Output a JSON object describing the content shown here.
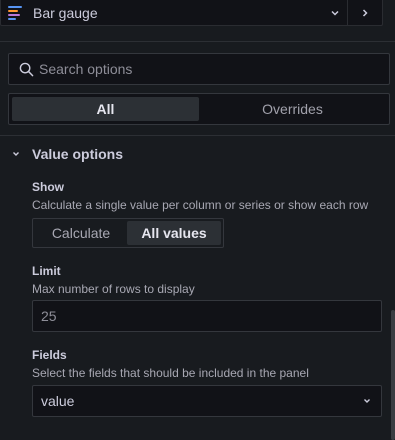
{
  "visualization": {
    "name": "Bar gauge",
    "icon": "bar-gauge-icon",
    "icon_colors": [
      "#5794f2",
      "#ff9830",
      "#b877d9"
    ]
  },
  "search": {
    "placeholder": "Search options",
    "value": ""
  },
  "tabs": [
    {
      "label": "All",
      "active": true
    },
    {
      "label": "Overrides",
      "active": false
    }
  ],
  "section": {
    "title": "Value options",
    "expanded": true
  },
  "show": {
    "label": "Show",
    "description": "Calculate a single value per column or series or show each row",
    "options": [
      {
        "label": "Calculate",
        "active": false
      },
      {
        "label": "All values",
        "active": true
      }
    ]
  },
  "limit": {
    "label": "Limit",
    "description": "Max number of rows to display",
    "placeholder": "25"
  },
  "fields": {
    "label": "Fields",
    "description": "Select the fields that should be included in the panel",
    "value": "value"
  },
  "colors": {
    "background": "#181b1f",
    "input_background": "#111217",
    "border": "#34373d",
    "active_tab": "#2c3035"
  }
}
